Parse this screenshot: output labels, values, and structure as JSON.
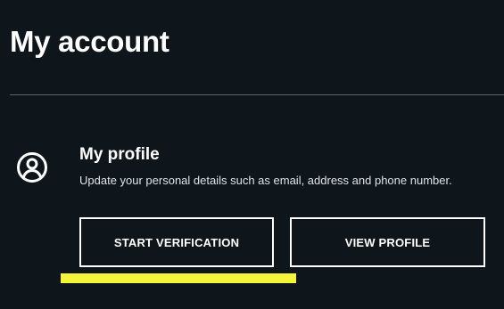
{
  "page": {
    "title": "My account"
  },
  "profile_section": {
    "icon": "user-circle-icon",
    "title": "My profile",
    "description": "Update your personal details such as email, address and phone number."
  },
  "buttons": {
    "start_verification": "START VERIFICATION",
    "view_profile": "VIEW PROFILE"
  },
  "colors": {
    "background": "#0e161b",
    "text": "#ffffff",
    "divider": "#5b6368",
    "highlight": "#f4f53a"
  }
}
